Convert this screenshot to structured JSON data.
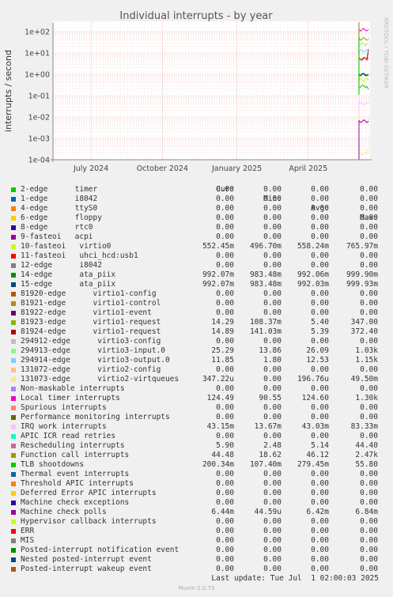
{
  "chart_data": {
    "type": "line",
    "title": "Individual interrupts - by year",
    "ylabel": "interrupts / second",
    "yscale": "log",
    "ylim": [
      0.0001,
      200
    ],
    "yticks": [
      "1e+02",
      "1e+01",
      "1e+00",
      "1e-01",
      "1e-02",
      "1e-03",
      "1e-04"
    ],
    "xticks": [
      "July 2024",
      "October 2024",
      "January 2025",
      "April 2025"
    ],
    "side_label": "RRDTOOL / TOBI OETIKER",
    "grid": true,
    "columns": [
      "Cur:",
      "Min:",
      "Avg:",
      "Max:"
    ],
    "series": [
      {
        "name": "2-edge      timer",
        "color": "#00cc00",
        "cur": "0.00",
        "min": "0.00",
        "avg": "0.00",
        "max": "0.00"
      },
      {
        "name": "1-edge      i8042",
        "color": "#0066b3",
        "cur": "0.00",
        "min": "0.00",
        "avg": "0.00",
        "max": "0.00"
      },
      {
        "name": "4-edge      ttyS0",
        "color": "#ff8000",
        "cur": "0.00",
        "min": "0.00",
        "avg": "0.00",
        "max": "0.00"
      },
      {
        "name": "6-edge      floppy",
        "color": "#ffcc00",
        "cur": "0.00",
        "min": "0.00",
        "avg": "0.00",
        "max": "0.00"
      },
      {
        "name": "8-edge      rtc0",
        "color": "#330099",
        "cur": "0.00",
        "min": "0.00",
        "avg": "0.00",
        "max": "0.00"
      },
      {
        "name": "9-fasteoi   acpi",
        "color": "#990099",
        "cur": "0.00",
        "min": "0.00",
        "avg": "0.00",
        "max": "0.00"
      },
      {
        "name": "10-fasteoi   virtio0",
        "color": "#ccff00",
        "cur": "552.45m",
        "min": "496.70m",
        "avg": "558.24m",
        "max": "765.97m"
      },
      {
        "name": "11-fasteoi   uhci_hcd:usb1",
        "color": "#ff0000",
        "cur": "0.00",
        "min": "0.00",
        "avg": "0.00",
        "max": "0.00"
      },
      {
        "name": "12-edge      i8042",
        "color": "#808080",
        "cur": "0.00",
        "min": "0.00",
        "avg": "0.00",
        "max": "0.00"
      },
      {
        "name": "14-edge      ata_piix",
        "color": "#008f00",
        "cur": "992.07m",
        "min": "983.48m",
        "avg": "992.06m",
        "max": "999.90m"
      },
      {
        "name": "15-edge      ata_piix",
        "color": "#00487d",
        "cur": "992.07m",
        "min": "983.48m",
        "avg": "992.03m",
        "max": "999.93m"
      },
      {
        "name": "81920-edge      virtio1-config",
        "color": "#b35a00",
        "cur": "0.00",
        "min": "0.00",
        "avg": "0.00",
        "max": "0.00"
      },
      {
        "name": "81921-edge      virtio1-control",
        "color": "#b38f00",
        "cur": "0.00",
        "min": "0.00",
        "avg": "0.00",
        "max": "0.00"
      },
      {
        "name": "81922-edge      virtio1-event",
        "color": "#6b006b",
        "cur": "0.00",
        "min": "0.00",
        "avg": "0.00",
        "max": "0.00"
      },
      {
        "name": "81923-edge      virtio1-request",
        "color": "#8fb300",
        "cur": "14.29",
        "min": "108.37m",
        "avg": "5.40",
        "max": "347.00"
      },
      {
        "name": "81924-edge      virtio1-request",
        "color": "#b30000",
        "cur": "14.89",
        "min": "141.03m",
        "avg": "5.39",
        "max": "372.40"
      },
      {
        "name": "294912-edge      virtio3-config",
        "color": "#bebebe",
        "cur": "0.00",
        "min": "0.00",
        "avg": "0.00",
        "max": "0.00"
      },
      {
        "name": "294913-edge      virtio3-input.0",
        "color": "#80ff80",
        "cur": "25.29",
        "min": "13.86",
        "avg": "26.09",
        "max": "1.03k"
      },
      {
        "name": "294914-edge      virtio3-output.0",
        "color": "#80c9ff",
        "cur": "11.85",
        "min": "1.80",
        "avg": "12.53",
        "max": "1.15k"
      },
      {
        "name": "131072-edge      virtio2-config",
        "color": "#ffc080",
        "cur": "0.00",
        "min": "0.00",
        "avg": "0.00",
        "max": "0.00"
      },
      {
        "name": "131073-edge      virtio2-virtqueues",
        "color": "#ffe680",
        "cur": "347.22u",
        "min": "0.00",
        "avg": "196.76u",
        "max": "49.50m"
      },
      {
        "name": "Non-maskable interrupts",
        "color": "#aa80ff",
        "cur": "0.00",
        "min": "0.00",
        "avg": "0.00",
        "max": "0.00"
      },
      {
        "name": "Local timer interrupts",
        "color": "#ee00cc",
        "cur": "124.49",
        "min": "90.55",
        "avg": "124.60",
        "max": "1.30k"
      },
      {
        "name": "Spurious interrupts",
        "color": "#ff8080",
        "cur": "0.00",
        "min": "0.00",
        "avg": "0.00",
        "max": "0.00"
      },
      {
        "name": "Performance monitoring interrupts",
        "color": "#666600",
        "cur": "0.00",
        "min": "0.00",
        "avg": "0.00",
        "max": "0.00"
      },
      {
        "name": "IRQ work interrupts",
        "color": "#ffbfff",
        "cur": "43.15m",
        "min": "13.67m",
        "avg": "43.03m",
        "max": "83.33m"
      },
      {
        "name": "APIC ICR read retries",
        "color": "#00ffcc",
        "cur": "0.00",
        "min": "0.00",
        "avg": "0.00",
        "max": "0.00"
      },
      {
        "name": "Rescheduling interrupts",
        "color": "#cc6699",
        "cur": "5.90",
        "min": "2.48",
        "avg": "5.14",
        "max": "44.40"
      },
      {
        "name": "Function call interrupts",
        "color": "#999900",
        "cur": "44.48",
        "min": "18.62",
        "avg": "46.12",
        "max": "2.47k"
      },
      {
        "name": "TLB shootdowns",
        "color": "#00cc00",
        "cur": "200.34m",
        "min": "107.40m",
        "avg": "279.45m",
        "max": "55.80"
      },
      {
        "name": "Thermal event interrupts",
        "color": "#0066b3",
        "cur": "0.00",
        "min": "0.00",
        "avg": "0.00",
        "max": "0.00"
      },
      {
        "name": "Threshold APIC interrupts",
        "color": "#ff8000",
        "cur": "0.00",
        "min": "0.00",
        "avg": "0.00",
        "max": "0.00"
      },
      {
        "name": "Deferred Error APIC interrupts",
        "color": "#ffcc00",
        "cur": "0.00",
        "min": "0.00",
        "avg": "0.00",
        "max": "0.00"
      },
      {
        "name": "Machine check exceptions",
        "color": "#330099",
        "cur": "0.00",
        "min": "0.00",
        "avg": "0.00",
        "max": "0.00"
      },
      {
        "name": "Machine check polls",
        "color": "#990099",
        "cur": "6.44m",
        "min": "44.59u",
        "avg": "6.42m",
        "max": "6.84m"
      },
      {
        "name": "Hypervisor callback interrupts",
        "color": "#ccff00",
        "cur": "0.00",
        "min": "0.00",
        "avg": "0.00",
        "max": "0.00"
      },
      {
        "name": "ERR",
        "color": "#ff0000",
        "cur": "0.00",
        "min": "0.00",
        "avg": "0.00",
        "max": "0.00"
      },
      {
        "name": "MIS",
        "color": "#808080",
        "cur": "0.00",
        "min": "0.00",
        "avg": "0.00",
        "max": "0.00"
      },
      {
        "name": "Posted-interrupt notification event",
        "color": "#008f00",
        "cur": "0.00",
        "min": "0.00",
        "avg": "0.00",
        "max": "0.00"
      },
      {
        "name": "Nested posted-interrupt event",
        "color": "#00487d",
        "cur": "0.00",
        "min": "0.00",
        "avg": "0.00",
        "max": "0.00"
      },
      {
        "name": "Posted-interrupt wakeup event",
        "color": "#b35a00",
        "cur": "0.00",
        "min": "0.00",
        "avg": "0.00",
        "max": "0.00"
      }
    ]
  },
  "footer": {
    "last_update": "Last update: Tue Jul  1 02:00:03 2025",
    "munin_version": "Munin 2.0.73"
  }
}
